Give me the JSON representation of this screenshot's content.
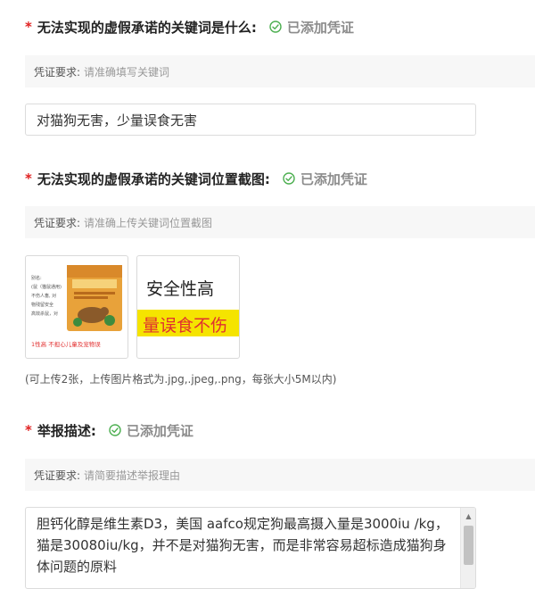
{
  "colors": {
    "required_star": "#e02020",
    "status_gray": "#8c8c8c",
    "requirement_bg": "#f7f7f7",
    "thumb2_banner": "#f5e400",
    "thumb2_banner_text": "#e03030"
  },
  "icons": {
    "status": "check-circle-icon"
  },
  "sections": [
    {
      "required": "*",
      "title": "无法实现的虚假承诺的关键词是什么:",
      "status": "已添加凭证",
      "requirement_label": "凭证要求:",
      "requirement_text": "请准确填写关键词",
      "input_value": "对猫狗无害，少量误食无害"
    },
    {
      "required": "*",
      "title": "无法实现的虚假承诺的关键词位置截图:",
      "status": "已添加凭证",
      "requirement_label": "凭证要求:",
      "requirement_text": "请准确上传关键词位置截图",
      "images": [
        {
          "lines": [
            "别名:",
            "(鼠（猫鼠通用)",
            "不伤人畜, 对",
            "物残留安全",
            "高效杀鼠，对"
          ],
          "caption": "1性高 不担心儿童及宠物误"
        },
        {
          "line1": "安全性高",
          "line2": "量误食不伤"
        }
      ],
      "upload_hint": "(可上传2张，上传图片格式为.jpg,.jpeg,.png，每张大小5M以内)"
    },
    {
      "required": "*",
      "title": "举报描述:",
      "status": "已添加凭证",
      "requirement_label": "凭证要求:",
      "requirement_text": "请简要描述举报理由",
      "textarea_value": "胆钙化醇是维生素D3，美国 aafco规定狗最高摄入量是3000iu /kg，猫是30080iu/kg，并不是对猫狗无害，而是非常容易超标造成猫狗身体问题的原料"
    }
  ]
}
